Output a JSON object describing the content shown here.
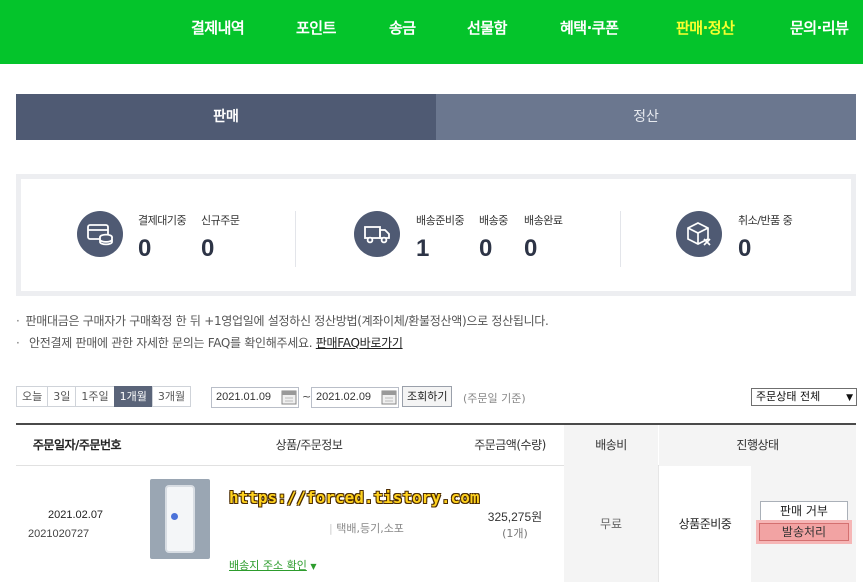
{
  "nav": {
    "items": [
      "결제내역",
      "포인트",
      "송금",
      "선물함",
      "혜택·쿠폰",
      "판매·정산",
      "문의·리뷰"
    ],
    "active": "판매·정산"
  },
  "tabs": [
    {
      "label": "판매",
      "active": true
    },
    {
      "label": "정산",
      "active": false
    }
  ],
  "summary": {
    "payment": {
      "icon": "card-icon",
      "stats": [
        {
          "label": "결제대기중",
          "value": "0"
        },
        {
          "label": "신규주문",
          "value": "0"
        }
      ]
    },
    "delivery": {
      "icon": "truck-icon",
      "stats": [
        {
          "label": "배송준비중",
          "value": "1"
        },
        {
          "label": "배송중",
          "value": "0"
        },
        {
          "label": "배송완료",
          "value": "0"
        }
      ]
    },
    "cancel": {
      "icon": "box-cancel-icon",
      "stats": [
        {
          "label": "취소/반품 중",
          "value": "0"
        }
      ]
    }
  },
  "notes": {
    "line1": "판매대금은 구매자가 구매확정 한 뒤 +1영업일에 설정하신 정산방법(계좌이체/환불정산액)으로 정산됩니다.",
    "line2_text": "안전결제 판매에 관한 자세한 문의는 FAQ를 확인해주세요.",
    "line2_link": "판매FAQ바로가기"
  },
  "filter": {
    "periods": [
      "오늘",
      "3일",
      "1주일",
      "1개월",
      "3개월"
    ],
    "active_period": "1개월",
    "start_date": "2021.01.09",
    "end_date": "2021.02.09",
    "tilde": "~",
    "search_label": "조회하기",
    "basis_note": "(주문일 기준)",
    "status_select": "주문상태 전체"
  },
  "table": {
    "headers": {
      "order": "주문일자/주문번호",
      "product": "상품/주문정보",
      "amount": "주문금액(수량)",
      "shipping": "배송비",
      "status": "진행상태"
    },
    "rows": [
      {
        "date": "2021.02.07",
        "order_no": "2021020727",
        "watermark": "https://forced.tistory.com",
        "options": "택배,등기,소포",
        "address_check": "배송지 주소 확인",
        "amount": "325,275원",
        "qty": "(1개)",
        "shipping": "무료",
        "status": "상품준비중",
        "refuse_label": "판매 거부",
        "ship_label": "발송처리"
      }
    ]
  }
}
